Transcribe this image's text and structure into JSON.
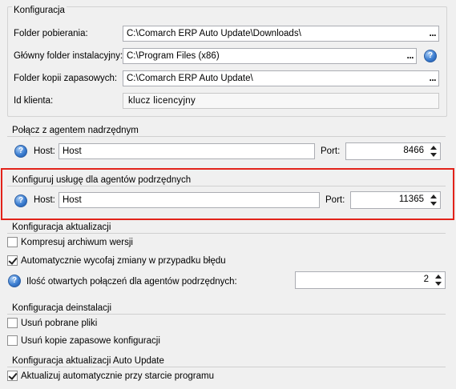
{
  "config": {
    "title": "Konfiguracja",
    "download_folder_label": "Folder pobierania:",
    "download_folder_value": "C:\\Comarch ERP Auto Update\\Downloads\\",
    "install_folder_label": "Główny folder instalacyjny:",
    "install_folder_value": "C:\\Program Files (x86)",
    "backup_folder_label": "Folder kopii zapasowych:",
    "backup_folder_value": "C:\\Comarch ERP Auto Update\\",
    "client_id_label": "Id klienta:",
    "client_id_value": "klucz licencyjny",
    "browse_label": "...",
    "help_glyph": "?"
  },
  "parent_agent": {
    "title": "Połącz z agentem nadrzędnym",
    "host_label": "Host:",
    "host_value": "Host",
    "port_label": "Port:",
    "port_value": "8466"
  },
  "child_agents": {
    "title": "Konfiguruj usługę dla agentów podrzędnych",
    "host_label": "Host:",
    "host_value": "Host",
    "port_label": "Port:",
    "port_value": "11365",
    "highlight_color": "#e2231a"
  },
  "update_config": {
    "title": "Konfiguracja aktualizacji",
    "compress_label": "Kompresuj archiwum wersji",
    "compress_checked": false,
    "rollback_label": "Automatycznie wycofaj zmiany w przypadku błędu",
    "rollback_checked": true,
    "connections_label": "Ilość otwartych połączeń dla agentów podrzędnych:",
    "connections_value": "2"
  },
  "uninstall_config": {
    "title": "Konfiguracja deinstalacji",
    "remove_downloads_label": "Usuń pobrane pliki",
    "remove_downloads_checked": false,
    "remove_backups_label": "Usuń kopie zapasowe konfiguracji",
    "remove_backups_checked": false
  },
  "autoupdate_config": {
    "title": "Konfiguracja aktualizacji Auto Update",
    "auto_update_label": "Aktualizuj automatycznie przy starcie programu",
    "auto_update_checked": true
  }
}
